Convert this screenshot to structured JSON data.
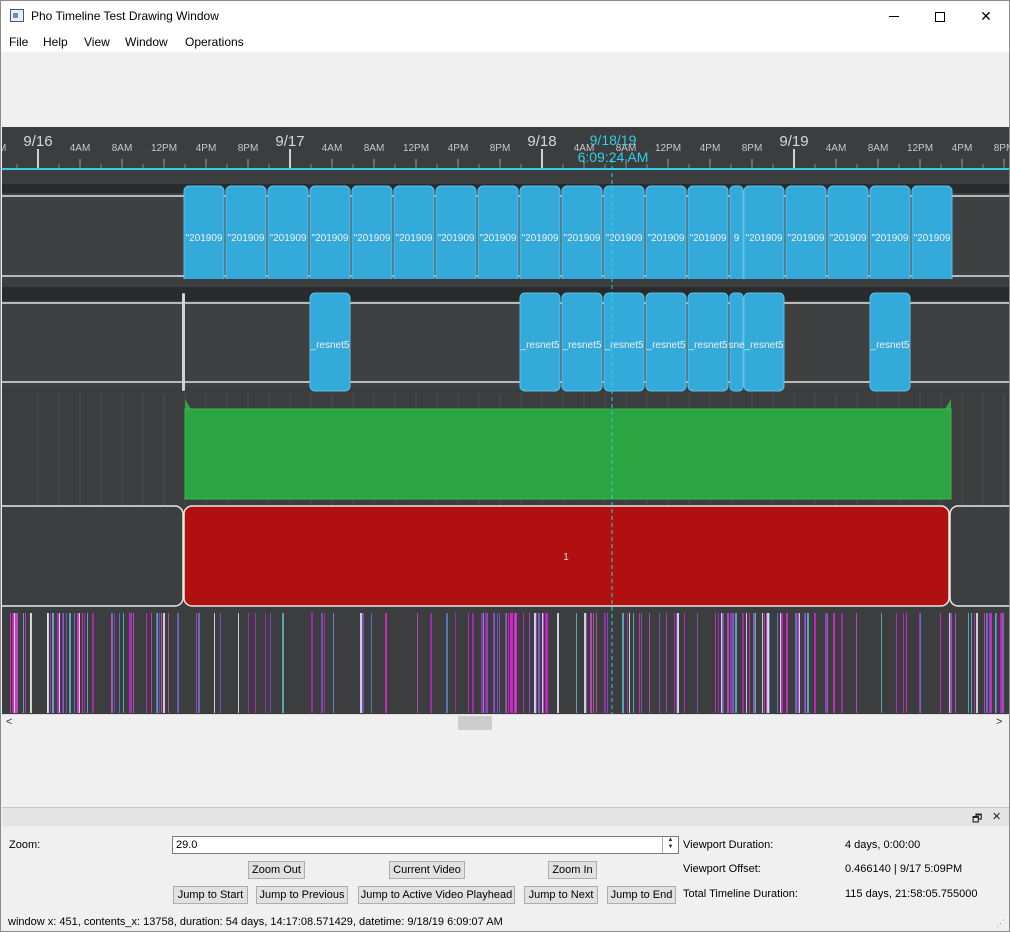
{
  "window": {
    "title": "Pho Timeline Test Drawing Window",
    "menu": [
      "File",
      "Help",
      "View",
      "Window",
      "Operations"
    ]
  },
  "ruler": {
    "date_labels": [
      "9/16",
      "9/17",
      "9/18",
      "9/19"
    ],
    "hour_labels": [
      "4AM",
      "8AM",
      "12PM",
      "4PM",
      "8PM"
    ],
    "playhead_date": "9/18/19",
    "playhead_time": "6:09:24 AM"
  },
  "tracks": {
    "video_clip_label": "\"201909",
    "video_clip_short_label": "9",
    "resnet_clip_label": "_resnet5",
    "resnet_clip_short_label": "sne",
    "partition_label": "1"
  },
  "colors": {
    "accent_cyan": "#2fd0e6",
    "clip_blue": "#33aad9",
    "green_block": "#2aa542",
    "red_block": "#b0100f",
    "track_bg": "#3b3d3f"
  },
  "controls": {
    "zoom_label": "Zoom:",
    "zoom_value": "29.0",
    "zoom_out": "Zoom Out",
    "current_video": "Current Video",
    "zoom_in": "Zoom In",
    "jump_start": "Jump to Start",
    "jump_previous": "Jump to Previous",
    "jump_playhead": "Jump to Active Video Playhead",
    "jump_next": "Jump to Next",
    "jump_end": "Jump to End",
    "viewport_duration_label": "Viewport Duration:",
    "viewport_duration_value": "4 days, 0:00:00",
    "viewport_offset_label": "Viewport Offset:",
    "viewport_offset_value": "0.466140 | 9/17 5:09PM",
    "total_duration_label": "Total Timeline Duration:",
    "total_duration_value": "115 days, 21:58:05.755000"
  },
  "status": "window x: 451, contents_x: 13758,  duration: 54 days, 14:17:08.571429, datetime: 9/18/19 6:09:07 AM"
}
